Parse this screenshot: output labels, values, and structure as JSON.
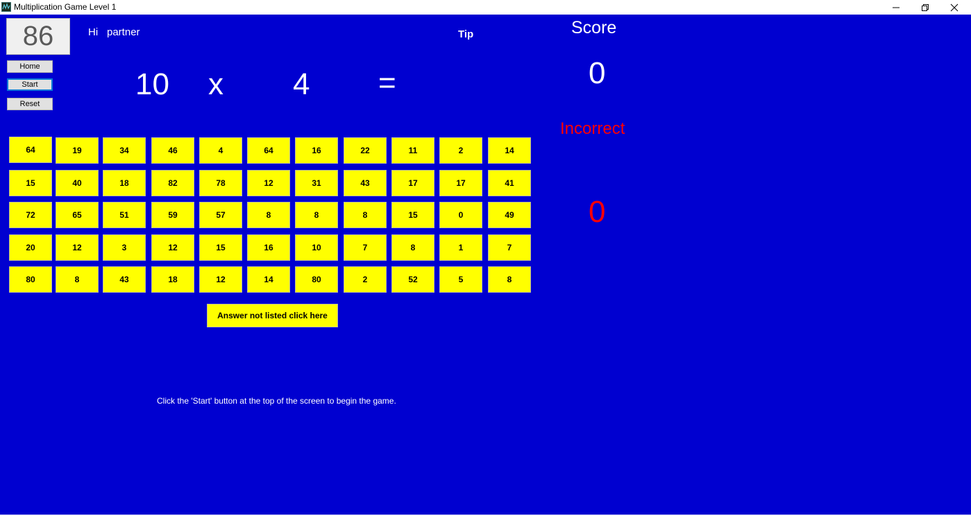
{
  "window": {
    "title": "Multiplication Game Level 1",
    "icon": "app-icon",
    "controls": [
      "minimize-icon",
      "restore-icon",
      "close-icon"
    ]
  },
  "colors": {
    "background": "#0000d0",
    "cell": "#ffff00",
    "incorrect": "#ff0000",
    "text": "#ffffff"
  },
  "counter": "86",
  "sidebar": {
    "home_label": "Home",
    "start_label": "Start",
    "reset_label": "Reset"
  },
  "greeting": {
    "hi": "Hi",
    "name": "partner"
  },
  "tip_label": "Tip",
  "equation": {
    "a": "10",
    "op": "x",
    "b": "4",
    "eq": "="
  },
  "score": {
    "label": "Score",
    "value": "0"
  },
  "incorrect": {
    "label": "Incorrect",
    "value": "0"
  },
  "answers": [
    [
      "64",
      "19",
      "34",
      "46",
      "4",
      "64",
      "16",
      "22",
      "11",
      "2",
      "14"
    ],
    [
      "15",
      "40",
      "18",
      "82",
      "78",
      "12",
      "31",
      "43",
      "17",
      "17",
      "41"
    ],
    [
      "72",
      "65",
      "51",
      "59",
      "57",
      "8",
      "8",
      "8",
      "15",
      "0",
      "49"
    ],
    [
      "20",
      "12",
      "3",
      "12",
      "15",
      "16",
      "10",
      "7",
      "8",
      "1",
      "7"
    ],
    [
      "80",
      "8",
      "43",
      "18",
      "12",
      "14",
      "80",
      "2",
      "52",
      "5",
      "8"
    ]
  ],
  "not_listed_label": "Answer not listed click here",
  "instructions": "Click the 'Start' button at the top of the screen to begin the game."
}
